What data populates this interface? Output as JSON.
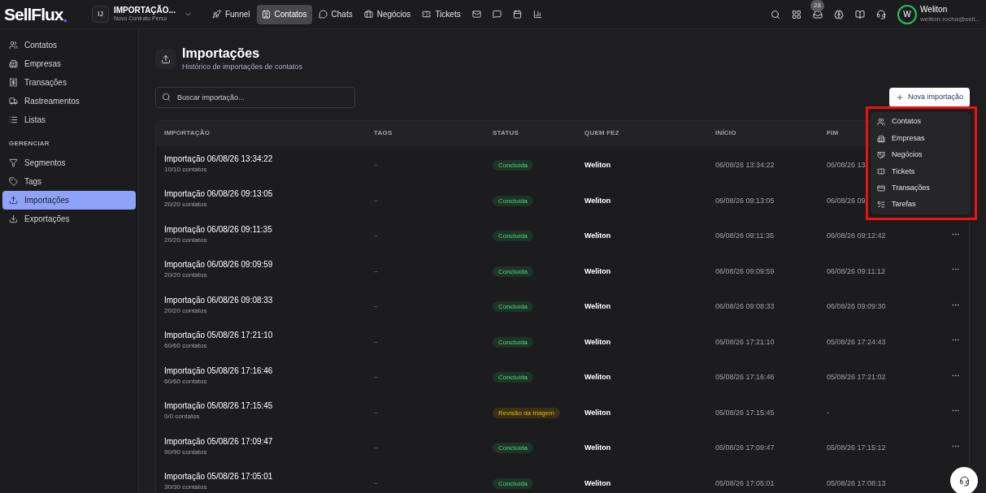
{
  "brand": {
    "logo": "SellFlux",
    "dot": "."
  },
  "workspace": {
    "initials": "IJ",
    "name": "IMPORTAÇÃO...",
    "subtitle": "Novo Contrato Perso"
  },
  "nav": [
    {
      "label": "Funnel",
      "selected": false
    },
    {
      "label": "Contatos",
      "selected": true
    },
    {
      "label": "Chats",
      "selected": false
    },
    {
      "label": "Negócios",
      "selected": false
    },
    {
      "label": "Tickets",
      "selected": false
    }
  ],
  "notifications": {
    "badge": "28"
  },
  "user": {
    "initial": "W",
    "name": "Weliton",
    "email": "weliton.rocha@sell..."
  },
  "sidebar": {
    "sections": [
      {
        "items": [
          {
            "label": "Contatos",
            "selected": false
          },
          {
            "label": "Empresas",
            "selected": false
          },
          {
            "label": "Transações",
            "selected": false
          },
          {
            "label": "Rastreamentos",
            "selected": false
          },
          {
            "label": "Listas",
            "selected": false
          }
        ]
      },
      {
        "heading": "GERENCIAR",
        "items": [
          {
            "label": "Segmentos",
            "selected": false
          },
          {
            "label": "Tags",
            "selected": false
          },
          {
            "label": "Importações",
            "selected": true
          },
          {
            "label": "Exportações",
            "selected": false
          }
        ]
      }
    ]
  },
  "page": {
    "title": "Importações",
    "subtitle": "Histórico de importações de contatos"
  },
  "search": {
    "placeholder": "Buscar importação..."
  },
  "new_button": {
    "label": "Nova importação"
  },
  "menu": {
    "items": [
      "Contatos",
      "Empresas",
      "Negócios",
      "Tickets",
      "Transações",
      "Tarefas"
    ]
  },
  "table": {
    "columns": [
      "IMPORTAÇÃO",
      "TAGS",
      "STATUS",
      "QUEM FEZ",
      "INÍCIO",
      "FIM"
    ],
    "rows": [
      {
        "title": "Importação 06/08/26 13:34:22",
        "count": "10/10 contatos",
        "tags": "–",
        "status": {
          "label": "Concluída",
          "kind": "done"
        },
        "who": "Weliton",
        "start": "06/08/26 13:34:22",
        "end": "06/08/26 13",
        "actions": false
      },
      {
        "title": "Importação 06/08/26 09:13:05",
        "count": "20/20 contatos",
        "tags": "–",
        "status": {
          "label": "Concluída",
          "kind": "done"
        },
        "who": "Weliton",
        "start": "06/08/26 09:13:05",
        "end": "06/08/26 09",
        "actions": false
      },
      {
        "title": "Importação 06/08/26 09:11:35",
        "count": "20/20 contatos",
        "tags": "–",
        "status": {
          "label": "Concluída",
          "kind": "done"
        },
        "who": "Weliton",
        "start": "06/08/26 09:11:35",
        "end": "06/08/26 09:12:42",
        "actions": true
      },
      {
        "title": "Importação 06/08/26 09:09:59",
        "count": "20/20 contatos",
        "tags": "–",
        "status": {
          "label": "Concluída",
          "kind": "done"
        },
        "who": "Weliton",
        "start": "06/08/26 09:09:59",
        "end": "06/08/26 09:11:12",
        "actions": true
      },
      {
        "title": "Importação 06/08/26 09:08:33",
        "count": "20/20 contatos",
        "tags": "–",
        "status": {
          "label": "Concluída",
          "kind": "done"
        },
        "who": "Weliton",
        "start": "06/08/26 09:08:33",
        "end": "06/08/26 09:09:30",
        "actions": true
      },
      {
        "title": "Importação 05/08/26 17:21:10",
        "count": "60/60 contatos",
        "tags": "–",
        "status": {
          "label": "Concluída",
          "kind": "done"
        },
        "who": "Weliton",
        "start": "05/08/26 17:21:10",
        "end": "05/08/26 17:24:43",
        "actions": true
      },
      {
        "title": "Importação 05/08/26 17:16:46",
        "count": "60/60 contatos",
        "tags": "–",
        "status": {
          "label": "Concluída",
          "kind": "done"
        },
        "who": "Weliton",
        "start": "05/08/26 17:16:46",
        "end": "05/08/26 17:21:02",
        "actions": true
      },
      {
        "title": "Importação 05/08/26 17:15:45",
        "count": "0/0 contatos",
        "tags": "–",
        "status": {
          "label": "Revisão da triagem",
          "kind": "review"
        },
        "who": "Weliton",
        "start": "05/08/26 17:15:45",
        "end": "-",
        "actions": true
      },
      {
        "title": "Importação 05/08/26 17:09:47",
        "count": "90/90 contatos",
        "tags": "–",
        "status": {
          "label": "Concluída",
          "kind": "done"
        },
        "who": "Weliton",
        "start": "05/08/26 17:09:47",
        "end": "05/08/26 17:15:12",
        "actions": true
      },
      {
        "title": "Importação 05/08/26 17:05:01",
        "count": "30/30 contatos",
        "tags": "–",
        "status": {
          "label": "Concluída",
          "kind": "done"
        },
        "who": "Weliton",
        "start": "05/08/26 17:05:01",
        "end": "05/08/26 17:08:13",
        "actions": false
      }
    ]
  }
}
